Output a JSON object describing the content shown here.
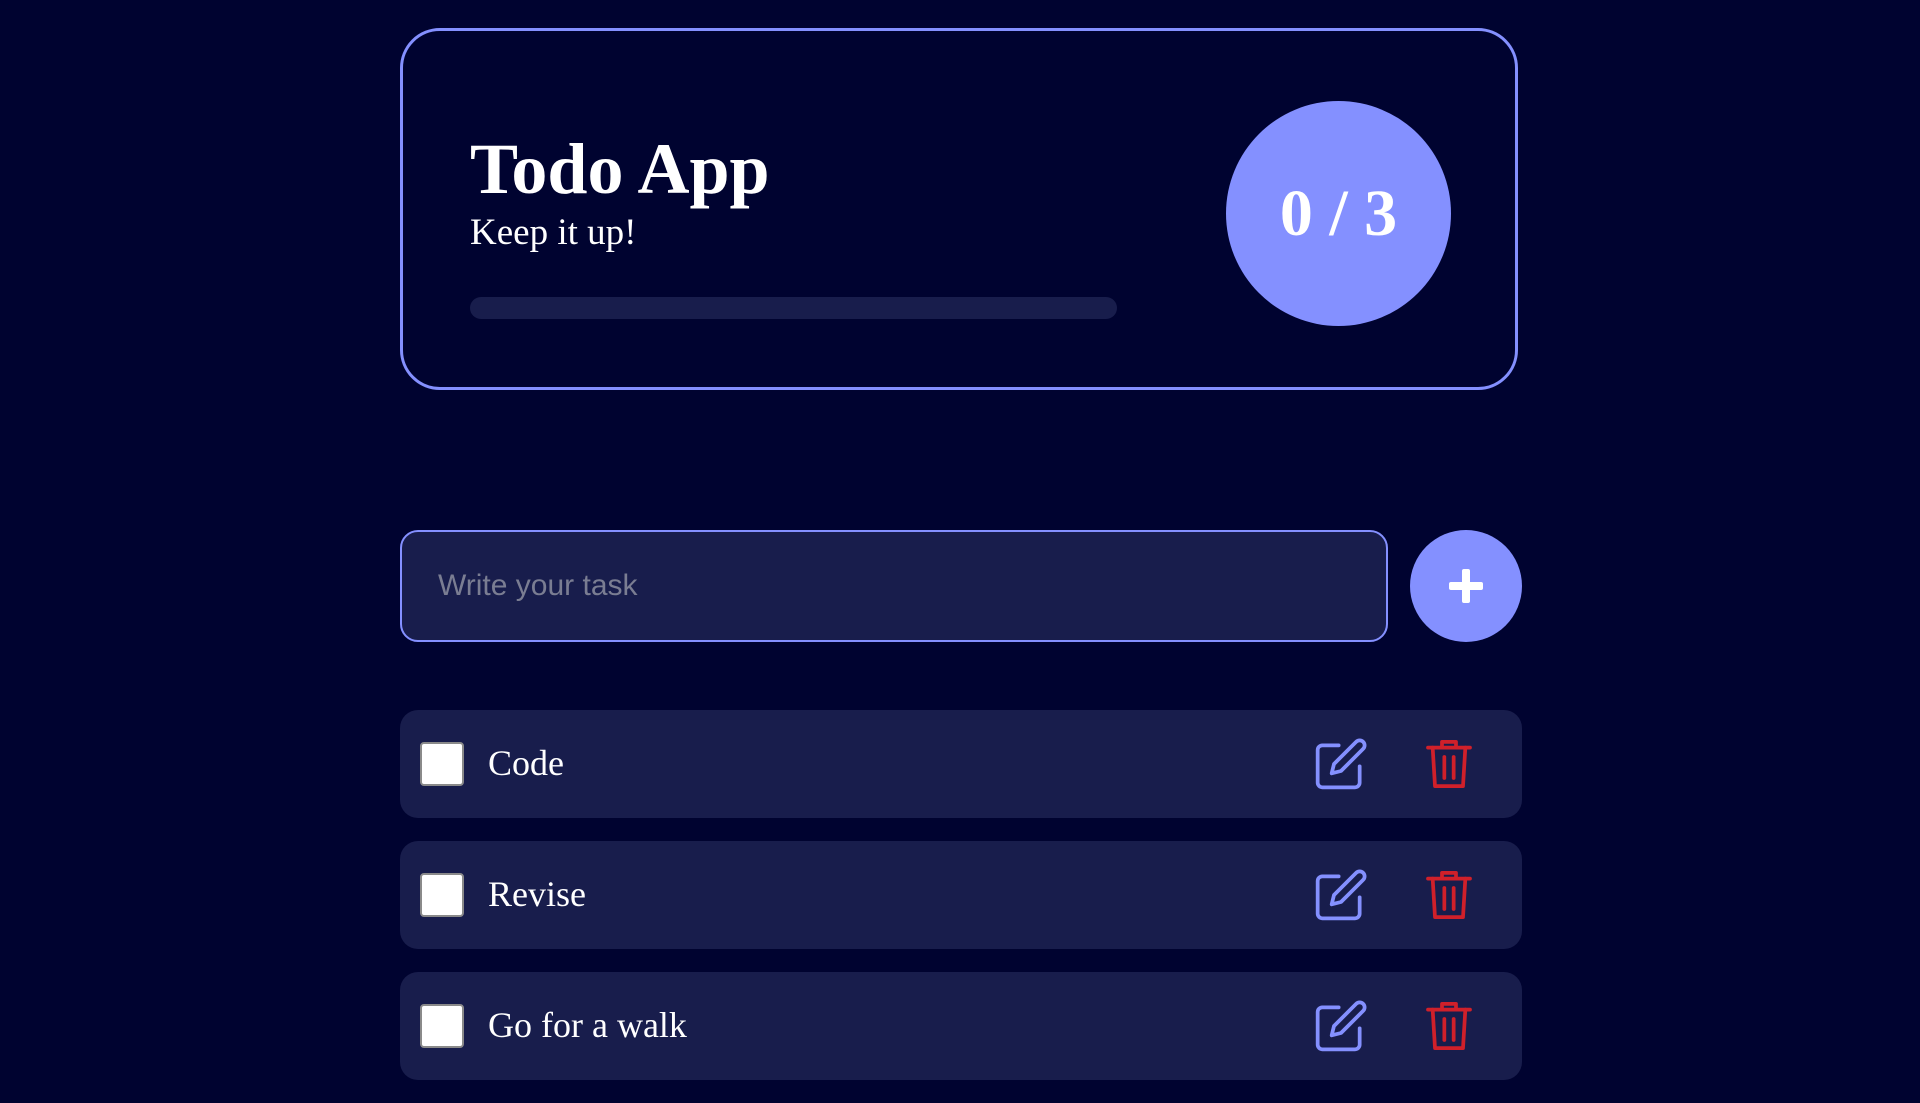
{
  "header": {
    "title": "Todo App",
    "subtitle": "Keep it up!",
    "counter": "0 / 3",
    "progress_fraction": 0
  },
  "input": {
    "placeholder": "Write your task",
    "value": ""
  },
  "add_button": {
    "icon": "plus-icon"
  },
  "todos": [
    {
      "text": "Code",
      "done": false,
      "edit_icon": "edit-icon",
      "delete_icon": "trash-icon"
    },
    {
      "text": "Revise",
      "done": false,
      "edit_icon": "edit-icon",
      "delete_icon": "trash-icon"
    },
    {
      "text": "Go for a walk",
      "done": false,
      "edit_icon": "edit-icon",
      "delete_icon": "trash-icon"
    }
  ],
  "colors": {
    "background": "#000330",
    "accent": "#8490ff",
    "card": "#181d4c",
    "danger": "#d0202a",
    "text": "#ffffff"
  }
}
